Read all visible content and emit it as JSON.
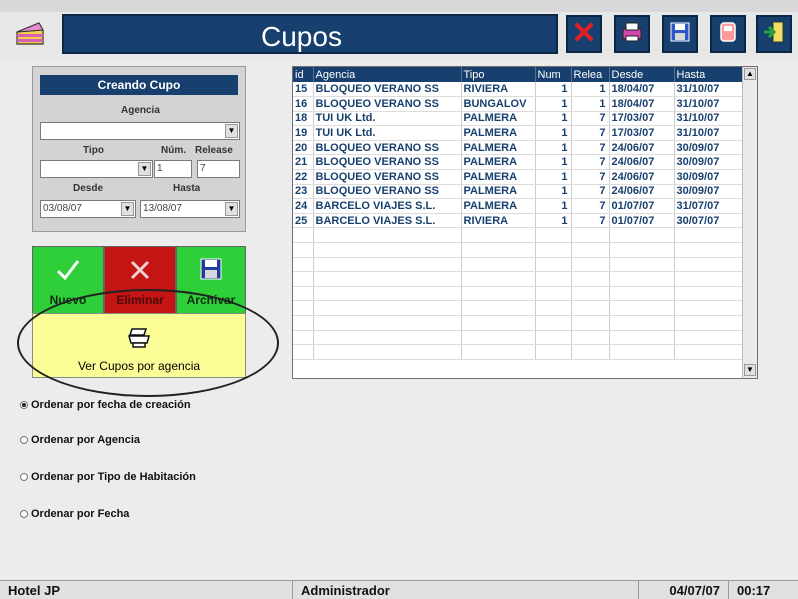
{
  "header": {
    "title": "Cupos",
    "app_icon": "cake-icon",
    "toolbar": [
      {
        "name": "delete-icon",
        "color": "#cc1b1b"
      },
      {
        "name": "print-icon",
        "color": "#c23aa0"
      },
      {
        "name": "save-icon",
        "color": "#2d4fbf"
      },
      {
        "name": "doc-icon",
        "color": "#ff8c8c"
      },
      {
        "name": "exit-icon",
        "color": "#29a23d"
      }
    ]
  },
  "form": {
    "header": "Creando Cupo",
    "agencia_label": "Agencia",
    "agencia_value": "",
    "tipo_label": "Tipo",
    "tipo_value": "",
    "num_label": "Núm.",
    "num_value": "1",
    "release_label": "Release",
    "release_value": "7",
    "desde_label": "Desde",
    "desde_value": "03/08/07",
    "hasta_label": "Hasta",
    "hasta_value": "13/08/07"
  },
  "actions": {
    "nuevo": "Nuevo",
    "eliminar": "Eliminar",
    "archivar": "Archivar",
    "ver_cupos": "Ver Cupos por agencia"
  },
  "colors": {
    "nuevo_bg": "#2fcf3a",
    "eliminar_bg": "#c41414",
    "archivar_bg": "#2fcf3a",
    "ver_bg": "#fbfd96",
    "header_navy": "#17406e"
  },
  "sort_options": [
    {
      "label": "Ordenar por fecha de creación",
      "selected": true
    },
    {
      "label": "Ordenar por Agencia",
      "selected": false
    },
    {
      "label": "Ordenar por Tipo de Habitación",
      "selected": false
    },
    {
      "label": "Ordenar por Fecha",
      "selected": false
    }
  ],
  "table": {
    "columns": [
      "id",
      "Agencia",
      "Tipo",
      "Num",
      "Relea",
      "Desde",
      "Hasta"
    ],
    "rows": [
      [
        "15",
        "BLOQUEO VERANO SS",
        "RIVIERA",
        "1",
        "1",
        "18/04/07",
        "31/10/07"
      ],
      [
        "16",
        "BLOQUEO VERANO SS",
        "BUNGALOV",
        "1",
        "1",
        "18/04/07",
        "31/10/07"
      ],
      [
        "18",
        "TUI UK Ltd.",
        "PALMERA",
        "1",
        "7",
        "17/03/07",
        "31/10/07"
      ],
      [
        "19",
        "TUI UK Ltd.",
        "PALMERA",
        "1",
        "7",
        "17/03/07",
        "31/10/07"
      ],
      [
        "20",
        "BLOQUEO VERANO SS",
        "PALMERA",
        "1",
        "7",
        "24/06/07",
        "30/09/07"
      ],
      [
        "21",
        "BLOQUEO VERANO SS",
        "PALMERA",
        "1",
        "7",
        "24/06/07",
        "30/09/07"
      ],
      [
        "22",
        "BLOQUEO VERANO SS",
        "PALMERA",
        "1",
        "7",
        "24/06/07",
        "30/09/07"
      ],
      [
        "23",
        "BLOQUEO VERANO SS",
        "PALMERA",
        "1",
        "7",
        "24/06/07",
        "30/09/07"
      ],
      [
        "24",
        "BARCELO VIAJES S.L.",
        "PALMERA",
        "1",
        "7",
        "01/07/07",
        "31/07/07"
      ],
      [
        "25",
        "BARCELO VIAJES S.L.",
        "RIVIERA",
        "1",
        "7",
        "01/07/07",
        "30/07/07"
      ]
    ],
    "empty_rows": 9
  },
  "status": {
    "hotel": "Hotel JP",
    "user": "Administrador",
    "date": "04/07/07",
    "time": "00:17"
  }
}
